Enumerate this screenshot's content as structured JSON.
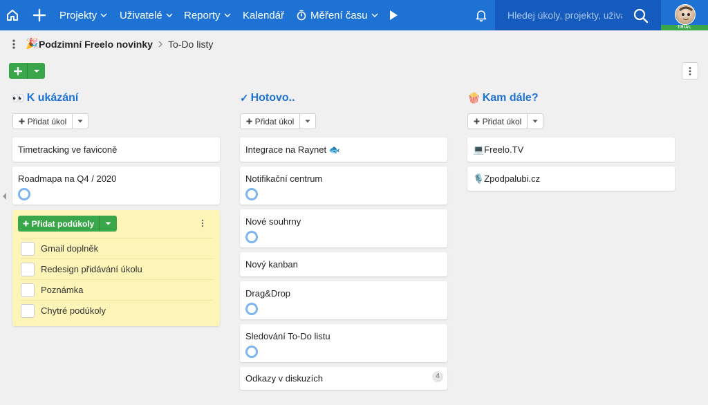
{
  "nav": {
    "home_icon": "home-icon",
    "plus_icon": "plus-icon",
    "projects": "Projekty",
    "users": "Uživatelé",
    "reports": "Reporty",
    "calendar": "Kalendář",
    "time_tracking": "Měření času",
    "play_icon": "play-icon",
    "bell_icon": "bell-icon",
    "search_placeholder": "Hledej úkoly, projekty, uživatele",
    "trial": "TRIAL"
  },
  "breadcrumb": {
    "project_emoji": "🎉",
    "project": "Podzimní Freelo novinky",
    "page": "To-Do listy"
  },
  "columns": [
    {
      "emoji": "👀",
      "title": "K ukázání",
      "add_label": "Přidat úkol",
      "cards": [
        {
          "title": "Timetracking ve faviconě"
        },
        {
          "title": "Roadmapa na Q4 / 2020"
        }
      ],
      "expanded": {
        "add_subtasks_label": "Přidat podúkoly",
        "subtasks": [
          "Gmail doplněk",
          "Redesign přidávání úkolu",
          "Poznámka",
          "Chytré podúkoly"
        ]
      }
    },
    {
      "emoji": "✓",
      "title": "Hotovo..",
      "add_label": "Přidat úkol",
      "cards": [
        {
          "title": "Integrace na Raynet 🐟"
        },
        {
          "title": "Notifikační centrum"
        },
        {
          "title": "Nové souhrny"
        },
        {
          "title": "Nový kanban"
        },
        {
          "title": "Drag&Drop"
        },
        {
          "title": "Sledování To-Do listu"
        },
        {
          "title": "Odkazy v diskuzích",
          "badge": "4"
        }
      ]
    },
    {
      "emoji": "🍿",
      "title": "Kam dále?",
      "add_label": "Přidat úkol",
      "cards": [
        {
          "title": "💻Freelo.TV"
        },
        {
          "title": "🎙️Zpodpalubi.cz"
        }
      ]
    }
  ],
  "colors": {
    "nav_blue": "#1d72d4",
    "search_blue": "#155bbd",
    "green": "#3aa64a",
    "yellow_card": "#fdf4b8",
    "progress_ring": "#7db5f0"
  }
}
